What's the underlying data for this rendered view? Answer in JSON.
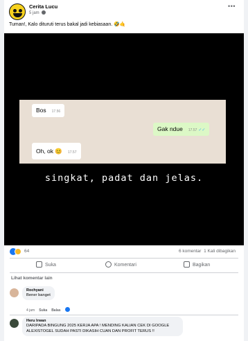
{
  "post": {
    "page_name": "Cerita Lucu",
    "time": "5 jam",
    "caption": "Tuman!, Kalo dituruti terus bakal jadi kebiasaan. 🤣🤙"
  },
  "chat": {
    "messages": [
      {
        "text": "Bos",
        "time": "17.56",
        "direction": "incoming"
      },
      {
        "text": "Gak ndue",
        "time": "17.57",
        "direction": "outgoing",
        "ticks": "✓✓"
      },
      {
        "text": "Oh, ok 😊",
        "time": "17.57",
        "direction": "incoming"
      }
    ],
    "tagline": "singkat, padat dan jelas."
  },
  "stats": {
    "reactions_count": "64",
    "comments": "6 komentar",
    "shares": "1 Kali dibagikan"
  },
  "actions": {
    "like": "Suka",
    "comment": "Komentari",
    "share": "Bagikan"
  },
  "comments_section": {
    "see_more": "Lihat komentar lain",
    "comments": [
      {
        "author": "Rochyani",
        "text": "Bener banget",
        "time": "4 jam",
        "like": "Suka",
        "reply": "Balas"
      },
      {
        "author": "Heru Irwan",
        "text": "DARIPADA BINGUNG 2025 KERJA APA ! MENDING KALIAN CEK DI GOOGLE ALEXISTOGEL SUDAH PASTI DIKASIH CUAN DAN PROFIT TERUS !!"
      }
    ]
  },
  "colors": {
    "facebook_blue": "#1877f2",
    "chat_outgoing": "#dcf8c6",
    "read_ticks": "#4fb6ec"
  }
}
